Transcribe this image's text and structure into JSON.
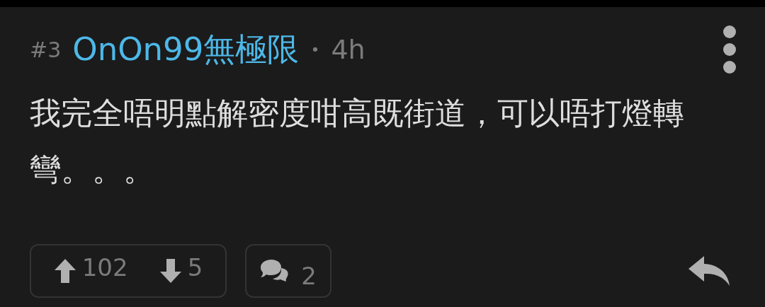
{
  "post": {
    "number": "#3",
    "author": "OnOn99無極限",
    "separator": "•",
    "time": "4h",
    "body": "我完全唔明點解密度咁高既街道，可以唔打燈轉彎。。。",
    "upvotes": "102",
    "downvotes": "5",
    "replies": "2"
  }
}
